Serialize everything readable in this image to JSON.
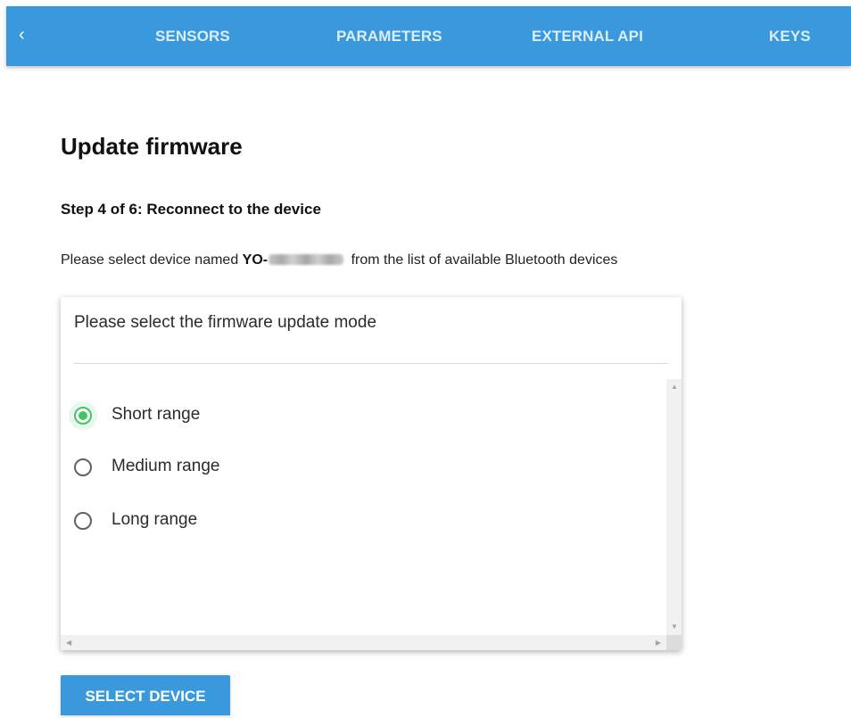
{
  "nav": {
    "back_icon": "chevron-left-icon",
    "back_glyph": "‹",
    "tabs": [
      {
        "label": "SENSORS"
      },
      {
        "label": "PARAMETERS"
      },
      {
        "label": "EXTERNAL API"
      },
      {
        "label": "KEYS"
      }
    ]
  },
  "page": {
    "title": "Update firmware",
    "step": "Step 4 of 6: Reconnect to the device",
    "instruction_before": "Please select device named ",
    "device_prefix": "YO-",
    "instruction_after": " from the list of available Bluetooth devices"
  },
  "dialog": {
    "title": "Please select the firmware update mode",
    "options": [
      {
        "label": "Short range",
        "selected": true
      },
      {
        "label": "Medium range",
        "selected": false
      },
      {
        "label": "Long range",
        "selected": false
      }
    ]
  },
  "actions": {
    "select_device_label": "SELECT DEVICE"
  },
  "colors": {
    "accent": "#3a99dc",
    "radio_selected": "#43c565"
  }
}
